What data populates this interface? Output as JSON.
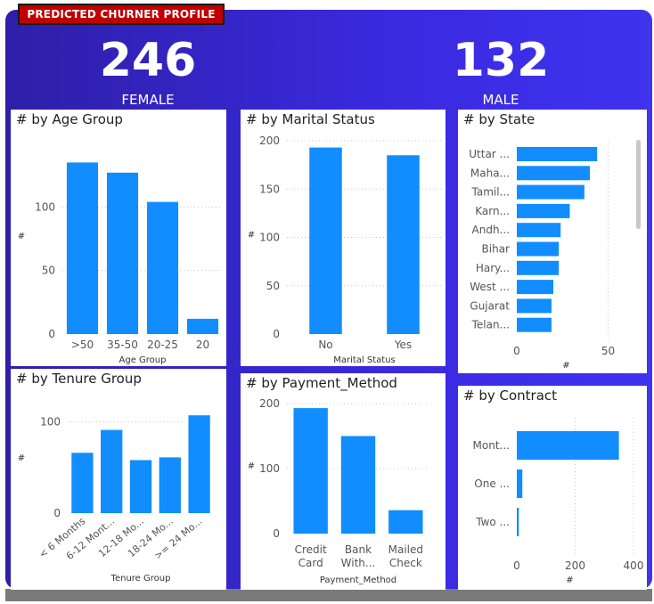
{
  "header": {
    "badge": "PREDICTED CHURNER PROFILE",
    "female_count": "246",
    "female_label": "FEMALE",
    "male_count": "132",
    "male_label": "MALE"
  },
  "colors": {
    "bar": "#118dff",
    "background": "#3a2ae0",
    "badge": "#c00000"
  },
  "chart_data": [
    {
      "id": "age",
      "type": "bar",
      "title": "# by Age Group",
      "categories": [
        ">50",
        "35-50",
        "20-25",
        "20"
      ],
      "values": [
        135,
        127,
        104,
        12
      ],
      "xlabel": "Age Group",
      "ylabel": "#",
      "yticks": [
        0,
        50,
        100
      ],
      "ylim": [
        0,
        150
      ]
    },
    {
      "id": "marital",
      "type": "bar",
      "title": "# by Marital Status",
      "categories": [
        "No",
        "Yes"
      ],
      "values": [
        193,
        185
      ],
      "xlabel": "Marital Status",
      "ylabel": "#",
      "yticks": [
        0,
        50,
        100,
        150,
        200
      ],
      "ylim": [
        0,
        200
      ]
    },
    {
      "id": "state",
      "type": "bar",
      "orientation": "horizontal",
      "title": "# by State",
      "categories": [
        "Uttar ...",
        "Maha...",
        "Tamil...",
        "Karn...",
        "Andh...",
        "Bihar",
        "Hary...",
        "West ...",
        "Gujarat",
        "Telan..."
      ],
      "values": [
        44,
        40,
        37,
        29,
        24,
        23,
        23,
        20,
        19,
        19
      ],
      "xlabel": "#",
      "xticks": [
        0,
        50
      ],
      "xlim": [
        0,
        60
      ]
    },
    {
      "id": "tenure",
      "type": "bar",
      "title": "# by Tenure Group",
      "categories": [
        "< 6 Months",
        "6-12 Mont...",
        "12-18 Mo...",
        "18-24 Mo...",
        ">= 24 Mo..."
      ],
      "values": [
        66,
        91,
        58,
        61,
        107
      ],
      "xlabel": "Tenure Group",
      "ylabel": "#",
      "yticks": [
        0,
        100
      ],
      "ylim": [
        0,
        115
      ]
    },
    {
      "id": "payment",
      "type": "bar",
      "title": "# by Payment_Method",
      "categories": [
        [
          "Credit",
          "Card"
        ],
        [
          "Bank",
          "With..."
        ],
        [
          "Mailed",
          "Check"
        ]
      ],
      "values": [
        193,
        150,
        36
      ],
      "xlabel": "Payment_Method",
      "ylabel": "#",
      "yticks": [
        0,
        100,
        200
      ],
      "ylim": [
        0,
        200
      ]
    },
    {
      "id": "contract",
      "type": "bar",
      "orientation": "horizontal",
      "title": "# by Contract",
      "categories": [
        "Mont...",
        "One ...",
        "Two ..."
      ],
      "values": [
        350,
        19,
        7
      ],
      "xlabel": "#",
      "xticks": [
        0,
        200,
        400
      ],
      "xlim": [
        0,
        400
      ]
    }
  ]
}
